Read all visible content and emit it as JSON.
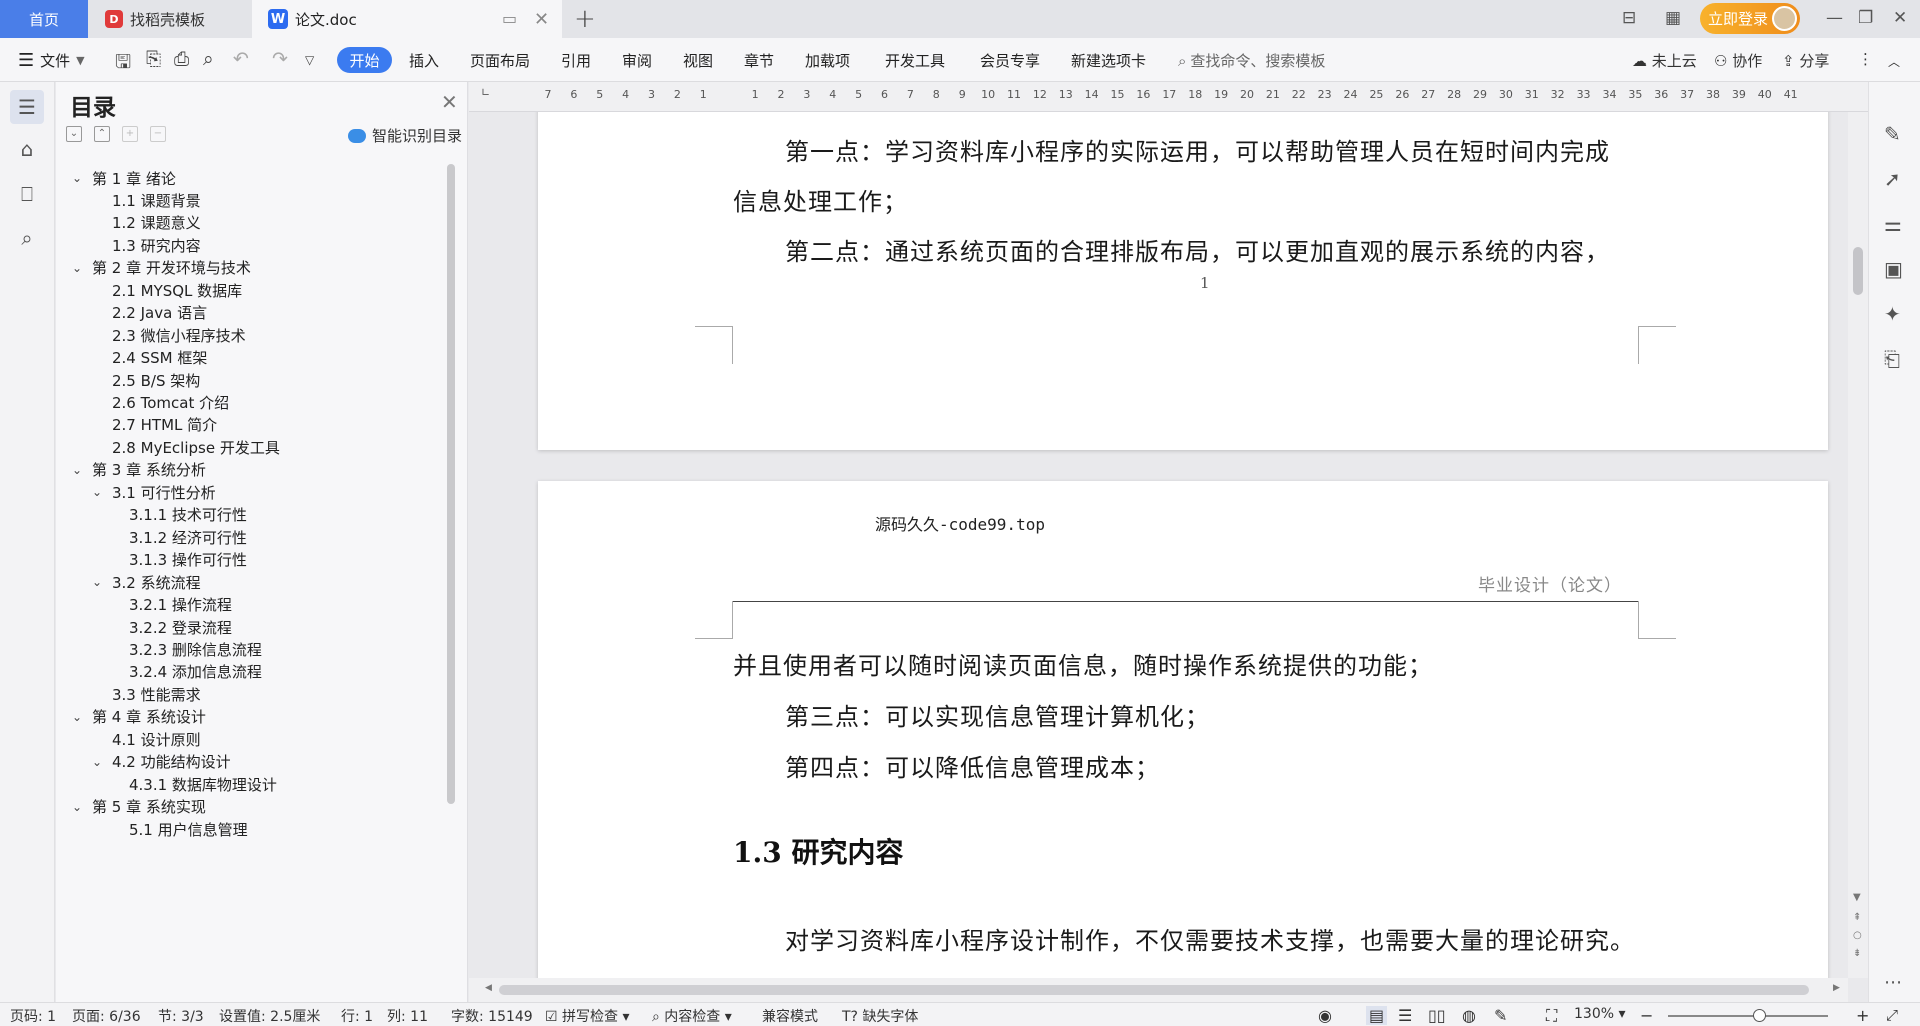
{
  "tabs": {
    "home": "首页",
    "templates": "找稻壳模板",
    "doc": "论文.doc"
  },
  "titlebar": {
    "login": "立即登录"
  },
  "ribbon": {
    "file": "文件",
    "tabs": [
      "开始",
      "插入",
      "页面布局",
      "引用",
      "审阅",
      "视图",
      "章节",
      "加载项",
      "开发工具",
      "会员专享",
      "新建选项卡"
    ],
    "search_placeholder": "查找命令、搜索模板",
    "cloud": "未上云",
    "collab": "协作",
    "share": "分享"
  },
  "toc": {
    "title": "目录",
    "smart": "智能识别目录",
    "items": [
      {
        "text": "第 1 章  绪论",
        "level": 0,
        "chev": true
      },
      {
        "text": "1.1  课题背景",
        "level": 1,
        "chev": false
      },
      {
        "text": "1.2  课题意义",
        "level": 1,
        "chev": false
      },
      {
        "text": "1.3  研究内容",
        "level": 1,
        "chev": false
      },
      {
        "text": "第 2 章  开发环境与技术",
        "level": 0,
        "chev": true
      },
      {
        "text": "2.1 MYSQL 数据库",
        "level": 1,
        "chev": false
      },
      {
        "text": "2.2 Java 语言",
        "level": 1,
        "chev": false
      },
      {
        "text": "2.3  微信小程序技术",
        "level": 1,
        "chev": false
      },
      {
        "text": "2.4 SSM 框架",
        "level": 1,
        "chev": false
      },
      {
        "text": "2.5 B/S 架构",
        "level": 1,
        "chev": false
      },
      {
        "text": "2.6 Tomcat  介绍",
        "level": 1,
        "chev": false
      },
      {
        "text": "2.7 HTML 简介",
        "level": 1,
        "chev": false
      },
      {
        "text": "2.8 MyEclipse 开发工具",
        "level": 1,
        "chev": false
      },
      {
        "text": "第 3 章  系统分析",
        "level": 0,
        "chev": true
      },
      {
        "text": "3.1  可行性分析",
        "level": 1,
        "chev": true
      },
      {
        "text": "3.1.1  技术可行性",
        "level": 2,
        "chev": false
      },
      {
        "text": "3.1.2  经济可行性",
        "level": 2,
        "chev": false
      },
      {
        "text": "3.1.3  操作可行性",
        "level": 2,
        "chev": false
      },
      {
        "text": "3.2  系统流程",
        "level": 1,
        "chev": true
      },
      {
        "text": "3.2.1  操作流程",
        "level": 2,
        "chev": false
      },
      {
        "text": "3.2.2  登录流程",
        "level": 2,
        "chev": false
      },
      {
        "text": "3.2.3  删除信息流程",
        "level": 2,
        "chev": false
      },
      {
        "text": "3.2.4  添加信息流程",
        "level": 2,
        "chev": false
      },
      {
        "text": "3.3  性能需求",
        "level": 1,
        "chev": false
      },
      {
        "text": "第 4 章  系统设计",
        "level": 0,
        "chev": true
      },
      {
        "text": "4.1  设计原则",
        "level": 1,
        "chev": false
      },
      {
        "text": "4.2  功能结构设计",
        "level": 1,
        "chev": true
      },
      {
        "text": "4.3.1  数据库物理设计",
        "level": 2,
        "chev": false
      },
      {
        "text": "第 5 章  系统实现",
        "level": 0,
        "chev": true
      },
      {
        "text": "5.1 用户信息管理",
        "level": 2,
        "chev": false
      }
    ]
  },
  "ruler": [
    "7",
    "6",
    "5",
    "4",
    "3",
    "2",
    "1",
    "",
    "1",
    "2",
    "3",
    "4",
    "5",
    "6",
    "7",
    "8",
    "9",
    "10",
    "11",
    "12",
    "13",
    "14",
    "15",
    "16",
    "17",
    "18",
    "19",
    "20",
    "21",
    "22",
    "23",
    "24",
    "25",
    "26",
    "27",
    "28",
    "29",
    "30",
    "31",
    "32",
    "33",
    "34",
    "35",
    "36",
    "37",
    "38",
    "39",
    "40",
    "41"
  ],
  "document": {
    "page1": {
      "line1": "第一点：学习资料库小程序的实际运用，可以帮助管理人员在短时间内完成",
      "line2": "信息处理工作；",
      "line3": "第二点：通过系统页面的合理排版布局，可以更加直观的展示系统的内容，",
      "page_number": "1"
    },
    "page2": {
      "header_left": "源码久久-code99.top",
      "header_right": "毕业设计（论文）",
      "line1": "并且使用者可以随时阅读页面信息，随时操作系统提供的功能；",
      "line2": "第三点：可以实现信息管理计算机化；",
      "line3": "第四点：可以降低信息管理成本；",
      "section_title": "1.3  研究内容",
      "line4": "对学习资料库小程序设计制作，不仅需要技术支撑，也需要大量的理论研究。"
    }
  },
  "status": {
    "page_code": "页码: 1",
    "page": "页面: 6/36",
    "section": "节: 3/3",
    "setting": "设置值: 2.5厘米",
    "row": "行: 1",
    "col": "列: 11",
    "words": "字数: 15149",
    "spell": "拼写检查",
    "content_check": "内容检查",
    "compat": "兼容模式",
    "missing_font": "缺失字体",
    "zoom": "130%"
  }
}
